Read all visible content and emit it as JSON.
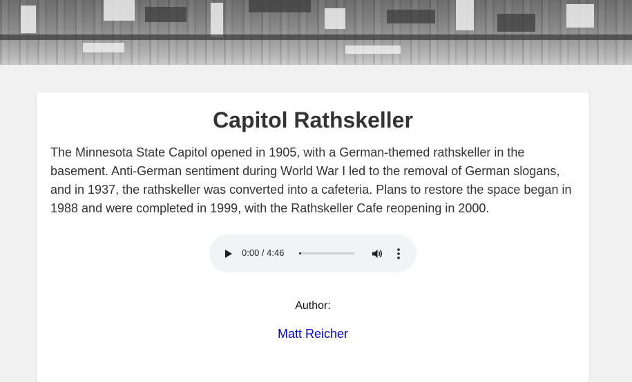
{
  "banner": {
    "description_icon": "historic-photo-banner"
  },
  "article": {
    "title": "Capitol Rathskeller",
    "description": "The Minnesota State Capitol opened in 1905, with a German-themed rathskeller in the basement. Anti-German sentiment during World War I led to the removal of German slogans, and in 1937, the rathskeller was converted into a cafeteria. Plans to restore the space began in 1988 and were completed in 1999, with the Rathskeller Cafe reopening in 2000."
  },
  "audio": {
    "time_display": "0:00 / 4:46",
    "progress": 0.0,
    "icons": {
      "play": "play-icon",
      "volume": "volume-icon",
      "more": "more-options-icon"
    }
  },
  "author": {
    "label": "Author:",
    "name": "Matt Reicher"
  },
  "colors": {
    "background": "#f1f1f1",
    "card": "#ffffff",
    "text": "#333333",
    "link": "#0000ee",
    "player_bg": "#f1f3f4"
  }
}
